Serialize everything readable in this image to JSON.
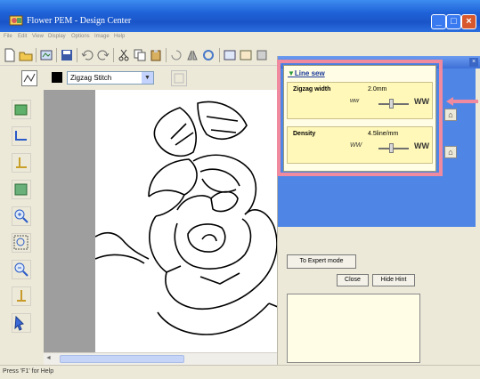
{
  "window": {
    "title": "Flower PEM - Design Center",
    "minimize": "_",
    "maximize": "□",
    "close": "×"
  },
  "menu": [
    "File",
    "Edit",
    "View",
    "Display",
    "Options",
    "Image",
    "Help"
  ],
  "toolbar2": {
    "stitch_type": "Zigzag Stitch",
    "select_arrow": "▼"
  },
  "panel": {
    "title": "Line sew",
    "title_marker": "▼",
    "zigzag": {
      "label": "Zigzag width",
      "value": "2.0mm",
      "min_icon": "ww",
      "max_icon": "WW"
    },
    "density": {
      "label": "Density",
      "value": "4.5line/mm",
      "min_icon": "WW",
      "max_icon": "WW"
    },
    "reset_glyph": "⌂",
    "close_glyph": "×"
  },
  "buttons": {
    "expert": "To Expert mode",
    "close": "Close",
    "hide_hint": "Hide Hint"
  },
  "scroll_arrow": "◄",
  "status": "Press 'F1' for Help",
  "colors": {
    "title_blue": "#1f62d8",
    "highlight": "#f08a9e",
    "panel_yellow": "#fffde6"
  }
}
